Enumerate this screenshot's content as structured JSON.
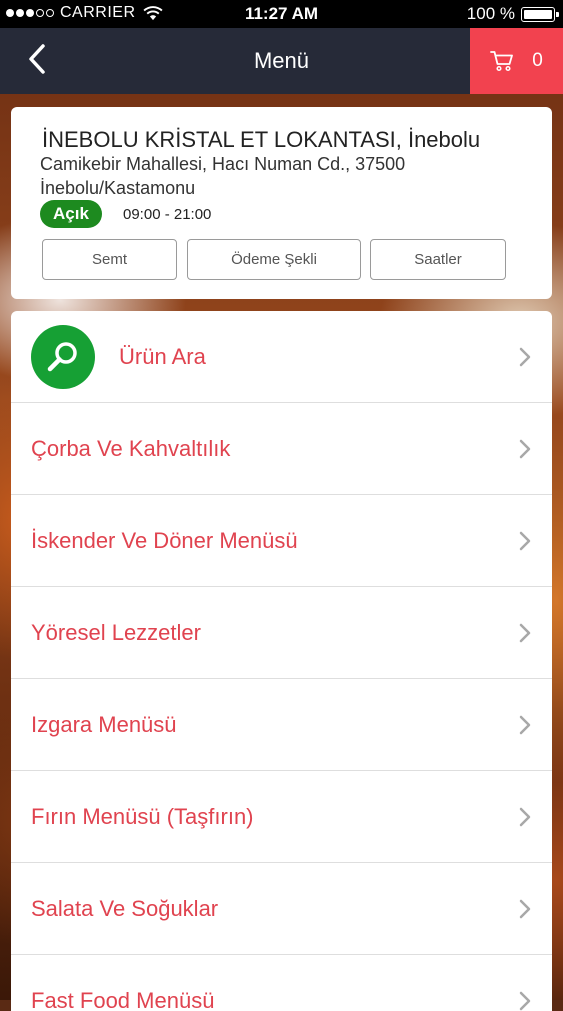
{
  "status_bar": {
    "carrier": "CARRIER",
    "time": "11:27 AM",
    "battery": "100 %"
  },
  "nav": {
    "title": "Menü",
    "cart_count": "0",
    "cart_color": "#f2424f",
    "bar_color": "#262a38"
  },
  "restaurant": {
    "name": "İNEBOLU KRİSTAL ET LOKANTASI, İnebolu",
    "address_line1": "Camikebir Mahallesi, Hacı Numan Cd., 37500",
    "address_line2": "İnebolu/Kastamonu",
    "status": "Açık",
    "status_color": "#1d8a1f",
    "hours": "09:00 - 21:00",
    "buttons": [
      "Semt",
      "Ödeme Şekli",
      "Saatler"
    ]
  },
  "menu": {
    "search_label": "Ürün Ara",
    "search_icon": "search-icon",
    "accent_color": "#e0434f",
    "categories": [
      "Çorba Ve Kahvaltılık",
      "İskender Ve Döner Menüsü",
      "Yöresel Lezzetler",
      "Izgara Menüsü",
      "Fırın Menüsü (Taşfırın)",
      "Salata Ve Soğuklar",
      "Fast Food Menüsü"
    ]
  }
}
